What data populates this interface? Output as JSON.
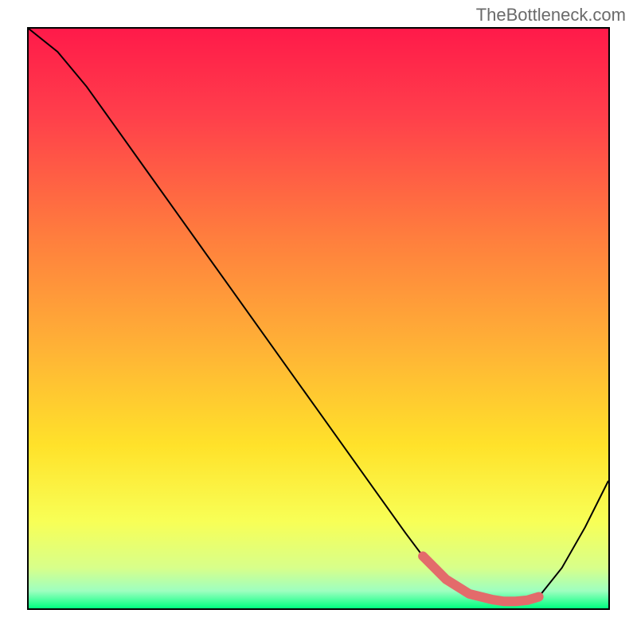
{
  "watermark": "TheBottleneck.com",
  "chart_data": {
    "type": "line",
    "title": "",
    "xlabel": "",
    "ylabel": "",
    "xlim": [
      0,
      100
    ],
    "ylim": [
      0,
      100
    ],
    "grid": false,
    "legend": false,
    "gradient_stops": [
      {
        "pos": 0.0,
        "color": "#ff1a4a"
      },
      {
        "pos": 0.15,
        "color": "#ff3f4b"
      },
      {
        "pos": 0.35,
        "color": "#ff7b3e"
      },
      {
        "pos": 0.55,
        "color": "#ffb236"
      },
      {
        "pos": 0.72,
        "color": "#ffe22a"
      },
      {
        "pos": 0.85,
        "color": "#f8ff56"
      },
      {
        "pos": 0.93,
        "color": "#d8ff8a"
      },
      {
        "pos": 0.97,
        "color": "#9effc0"
      },
      {
        "pos": 1.0,
        "color": "#00ff80"
      }
    ],
    "series": [
      {
        "name": "bottleneck-curve",
        "color": "#000000",
        "x": [
          0,
          5,
          10,
          15,
          20,
          25,
          30,
          35,
          40,
          45,
          50,
          55,
          60,
          65,
          68,
          72,
          76,
          80,
          82,
          84,
          86,
          88,
          92,
          96,
          100
        ],
        "y": [
          100,
          96,
          90,
          83,
          76,
          69,
          62,
          55,
          48,
          41,
          34,
          27,
          20,
          13,
          9,
          5,
          2.5,
          1.5,
          1.2,
          1.2,
          1.4,
          2,
          7,
          14,
          22
        ]
      },
      {
        "name": "optimal-range-marker",
        "color": "#e36b6b",
        "x": [
          68,
          72,
          76,
          80,
          82,
          84,
          86,
          88
        ],
        "y": [
          9,
          5,
          2.5,
          1.5,
          1.2,
          1.2,
          1.4,
          2
        ]
      }
    ]
  }
}
